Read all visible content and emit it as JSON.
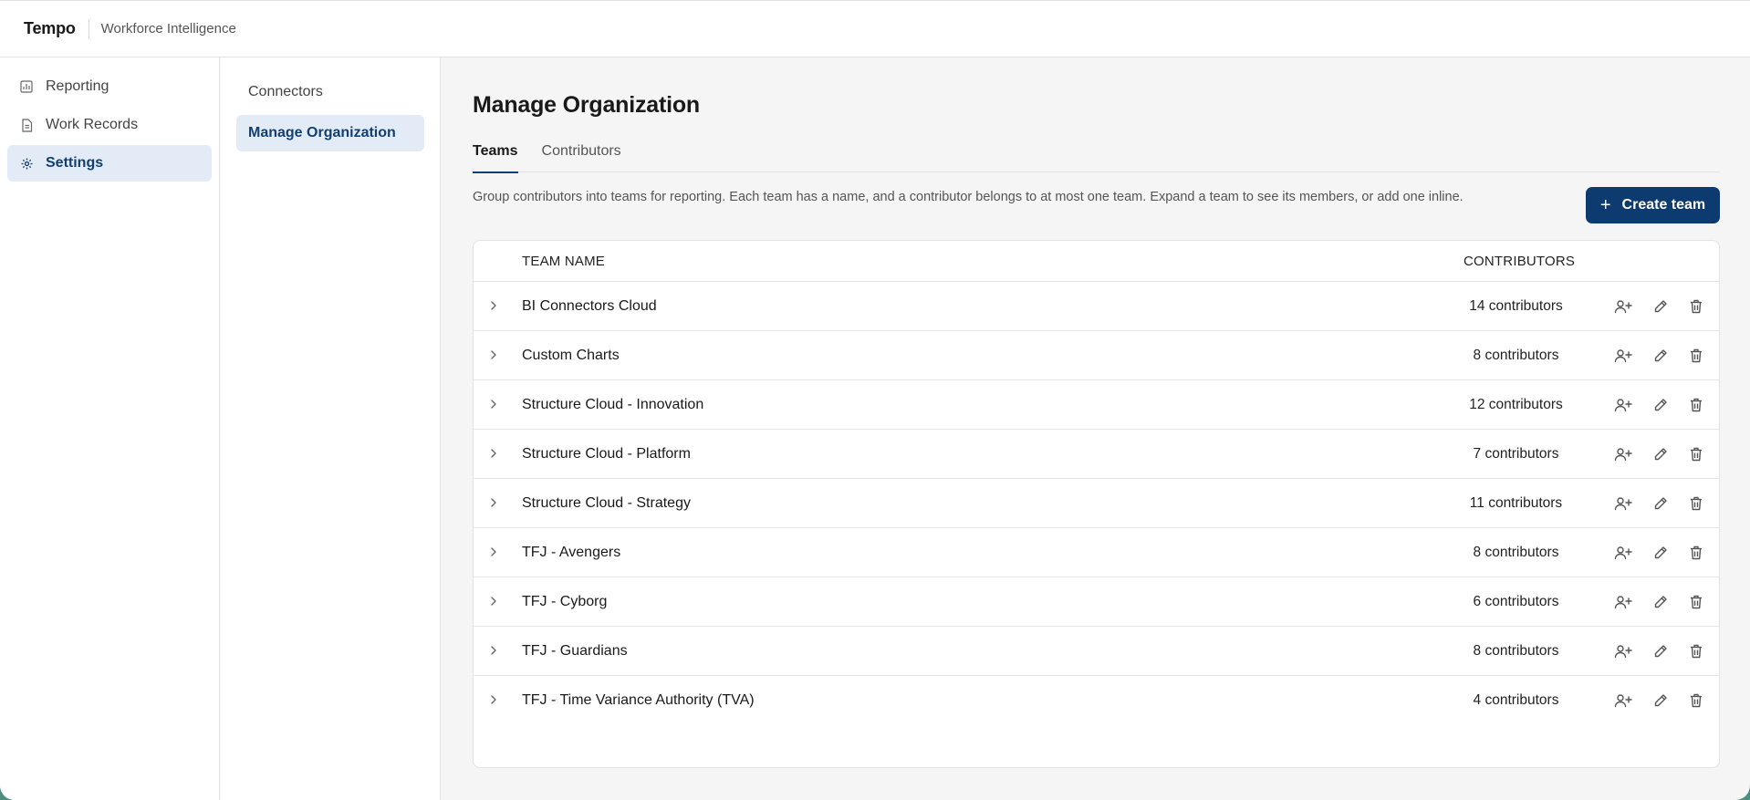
{
  "app": {
    "name": "Tempo",
    "subtitle": "Workforce Intelligence"
  },
  "sidebar": {
    "items": [
      {
        "label": "Reporting",
        "icon": "chart-icon",
        "active": false
      },
      {
        "label": "Work Records",
        "icon": "document-icon",
        "active": false
      },
      {
        "label": "Settings",
        "icon": "gear-icon",
        "active": true
      }
    ]
  },
  "subnav": {
    "items": [
      {
        "label": "Connectors",
        "active": false
      },
      {
        "label": "Manage Organization",
        "active": true
      }
    ]
  },
  "main": {
    "title": "Manage Organization",
    "tabs": [
      {
        "label": "Teams",
        "active": true
      },
      {
        "label": "Contributors",
        "active": false
      }
    ],
    "description": "Group contributors into teams for reporting. Each team has a name, and a contributor belongs to at most one team. Expand a team to see its members, or add one inline.",
    "create_button": {
      "icon": "plus-icon",
      "label": "Create team"
    }
  },
  "table": {
    "columns": {
      "name": "TEAM NAME",
      "contributors": "CONTRIBUTORS"
    },
    "rows": [
      {
        "name": "BI Connectors Cloud",
        "count": "14 contributors"
      },
      {
        "name": "Custom Charts",
        "count": "8 contributors"
      },
      {
        "name": "Structure Cloud - Innovation",
        "count": "12 contributors"
      },
      {
        "name": "Structure Cloud - Platform",
        "count": "7 contributors"
      },
      {
        "name": "Structure Cloud - Strategy",
        "count": "11 contributors"
      },
      {
        "name": "TFJ - Avengers",
        "count": "8 contributors"
      },
      {
        "name": "TFJ - Cyborg",
        "count": "6 contributors"
      },
      {
        "name": "TFJ - Guardians",
        "count": "8 contributors"
      },
      {
        "name": "TFJ - Time Variance Authority (TVA)",
        "count": "4 contributors"
      }
    ],
    "row_actions": [
      "add-member-icon",
      "edit-icon",
      "delete-icon"
    ]
  },
  "colors": {
    "primary": "#0d3b70",
    "active_nav_bg": "#e3ecf6",
    "active_nav_text": "#123f73",
    "page_bg": "#f5f5f5"
  }
}
